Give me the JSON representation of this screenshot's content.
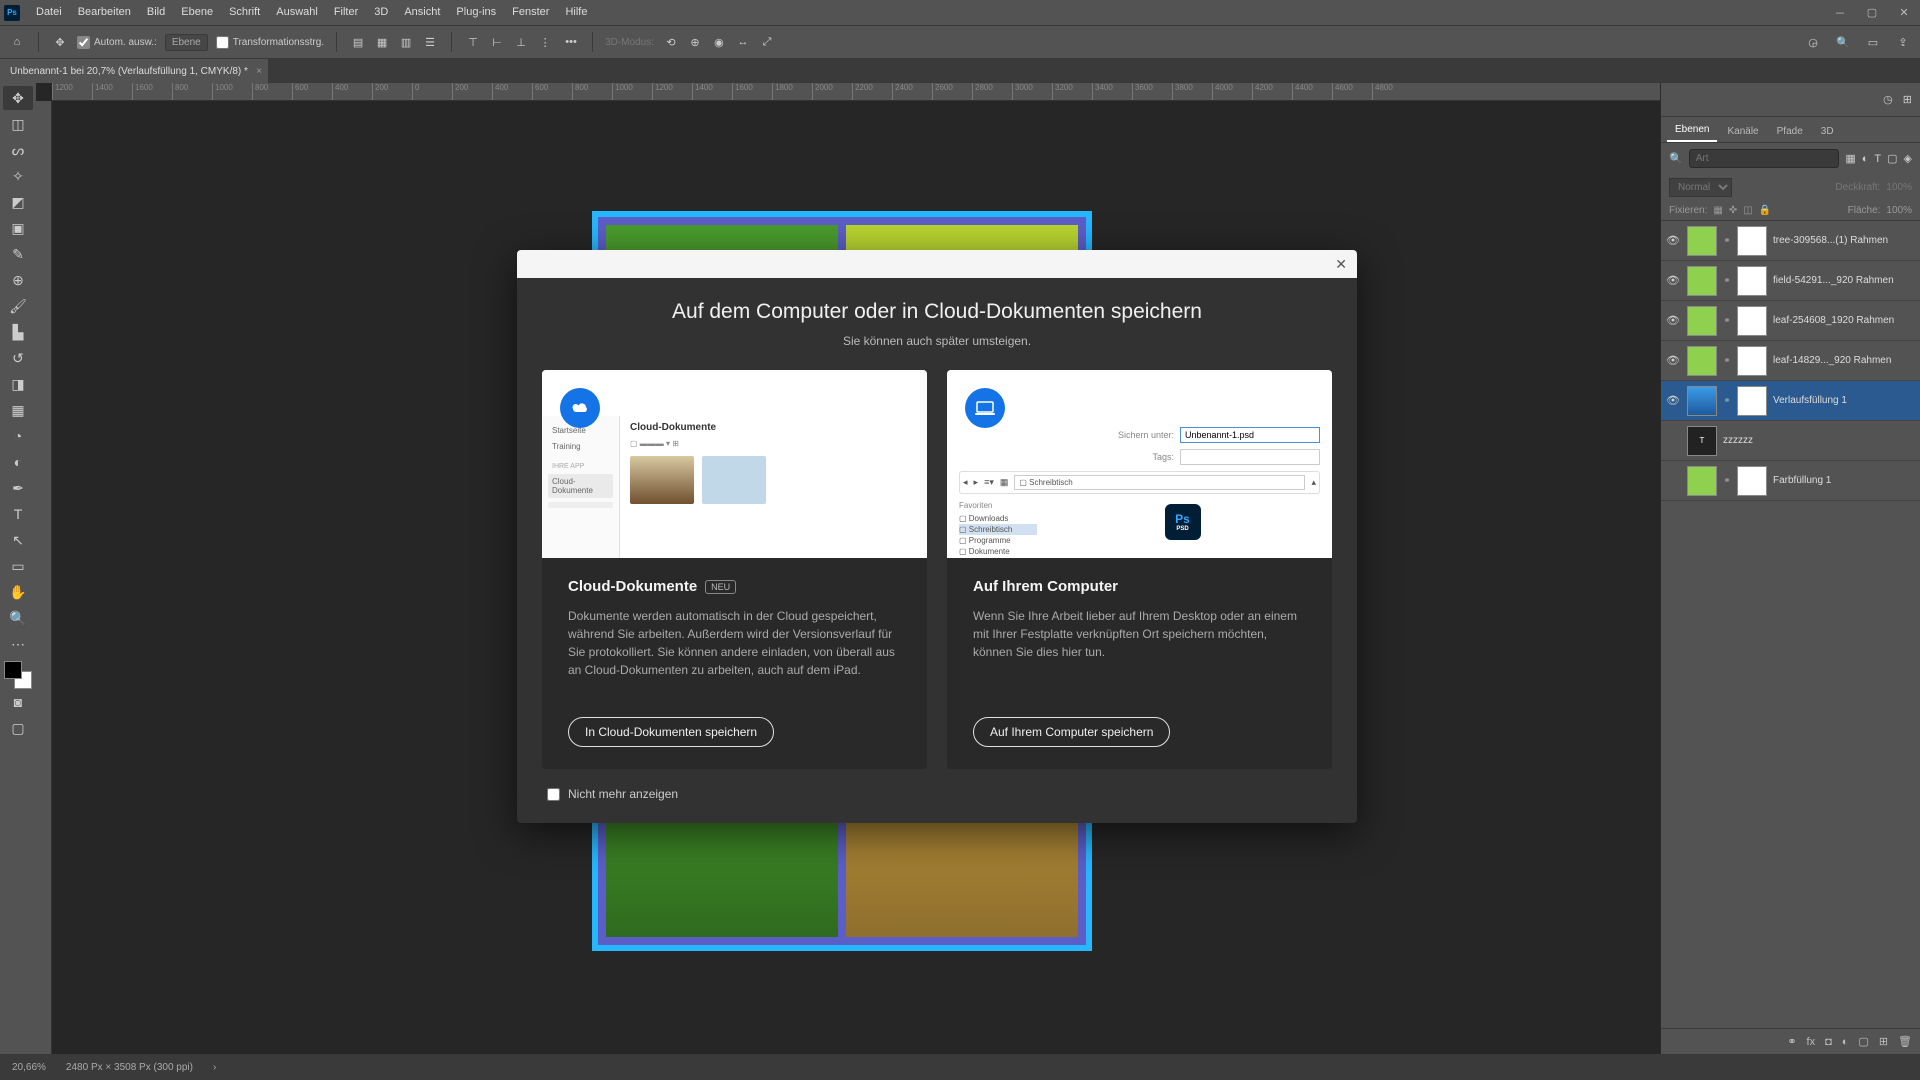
{
  "menubar": {
    "items": [
      "Datei",
      "Bearbeiten",
      "Bild",
      "Ebene",
      "Schrift",
      "Auswahl",
      "Filter",
      "3D",
      "Ansicht",
      "Plug-ins",
      "Fenster",
      "Hilfe"
    ]
  },
  "optbar": {
    "auto": "Autom. ausw.:",
    "ebene": "Ebene",
    "transform": "Transformationsstrg.",
    "mode3d": "3D-Modus:"
  },
  "doctab": {
    "title": "Unbenannt-1 bei 20,7% (Verlaufsfüllung 1, CMYK/8) *"
  },
  "ruler": [
    "1200",
    "1400",
    "1600",
    "800",
    "1000",
    "800",
    "600",
    "400",
    "200",
    "0",
    "200",
    "400",
    "600",
    "800",
    "1000",
    "1200",
    "1400",
    "1600",
    "1800",
    "2000",
    "2200",
    "2400",
    "2600",
    "2800",
    "3000",
    "3200",
    "3400",
    "3600",
    "3800",
    "4000",
    "4200",
    "4400",
    "4600",
    "4800"
  ],
  "panels": {
    "tabs": [
      "Ebenen",
      "Kanäle",
      "Pfade",
      "3D"
    ],
    "search_ph": "Art",
    "blend": "Normal",
    "opacity_lbl": "Deckkraft:",
    "opacity": "100%",
    "lock_lbl": "Fixieren:",
    "fill_lbl": "Fläche:",
    "fill": "100%",
    "layers": [
      {
        "name": "tree-309568...(1) Rahmen",
        "thumb": "green"
      },
      {
        "name": "field-54291..._920 Rahmen",
        "thumb": "green"
      },
      {
        "name": "leaf-254608_1920 Rahmen",
        "thumb": "green"
      },
      {
        "name": "leaf-14829..._920 Rahmen",
        "thumb": "green"
      },
      {
        "name": "Verlaufsfüllung 1",
        "thumb": "blue",
        "sel": true
      },
      {
        "name": "zzzzzz",
        "thumb": "txt",
        "noeye": true,
        "nomask": true
      },
      {
        "name": "Farbfüllung 1",
        "thumb": "green",
        "noeye": true
      }
    ]
  },
  "status": {
    "zoom": "20,66%",
    "dims": "2480 Px × 3508 Px (300 ppi)"
  },
  "dialog": {
    "title": "Auf dem Computer oder in Cloud-Dokumenten speichern",
    "sub": "Sie können auch später umsteigen.",
    "left": {
      "h": "Cloud-Dokumente",
      "neu": "NEU",
      "d": "Dokumente werden automatisch in der Cloud gespeichert, während Sie arbeiten. Außerdem wird der Versionsverlauf für Sie protokolliert. Sie können andere einladen, von überall aus an Cloud-Dokumenten zu arbeiten, auch auf dem iPad.",
      "btn": "In Cloud-Dokumenten speichern",
      "pv": {
        "startseite": "Startseite",
        "training": "Training",
        "share": "IHRE APP",
        "cloud": "Cloud-Dokumente",
        "title": "Cloud-Dokumente"
      }
    },
    "right": {
      "h": "Auf Ihrem Computer",
      "d": "Wenn Sie Ihre Arbeit lieber auf Ihrem Desktop oder an einem mit Ihrer Festplatte verknüpften Ort speichern möchten, können Sie dies hier tun.",
      "btn": "Auf Ihrem Computer speichern",
      "pv": {
        "saveas": "Sichern unter:",
        "filename": "Unbenannt-1.psd",
        "tags": "Tags:",
        "loc": "Schreibtisch",
        "fav": "Favoriten",
        "dl": "Downloads",
        "desk": "Schreibtisch",
        "prog": "Programme",
        "docs": "Dokumente",
        "ps": "Ps",
        "psd": "PSD"
      }
    },
    "dont": "Nicht mehr anzeigen"
  }
}
